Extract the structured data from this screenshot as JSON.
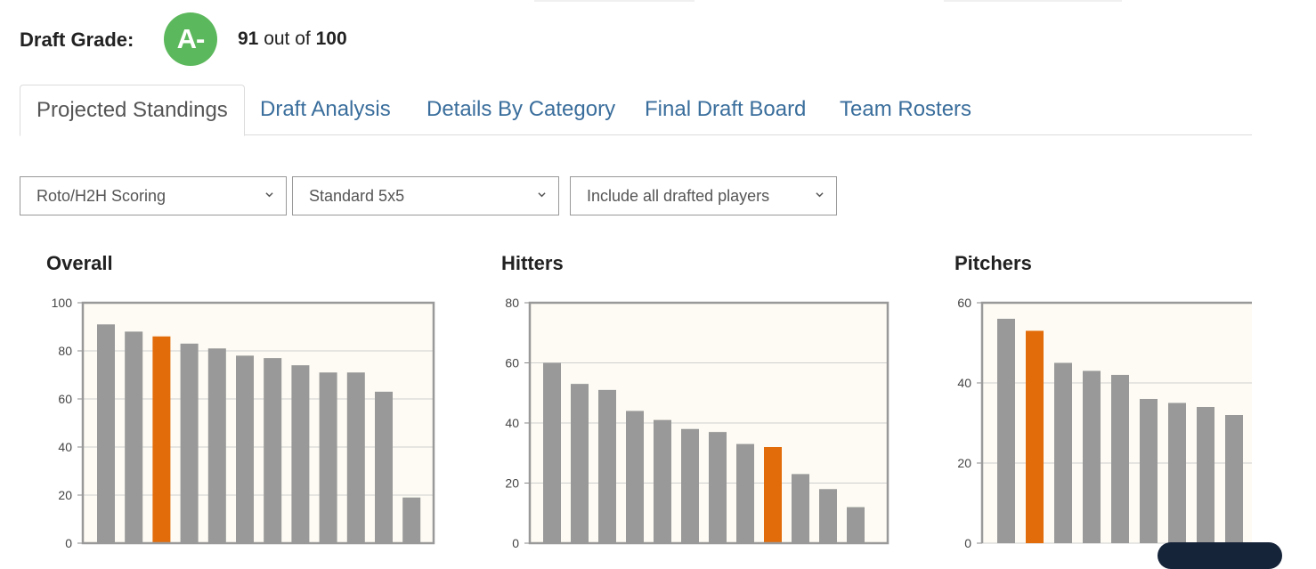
{
  "grade": {
    "label": "Draft Grade:",
    "letter": "A-",
    "score": "91",
    "out_of_text": "out of",
    "max": "100"
  },
  "tabs": [
    {
      "label": "Projected Standings",
      "active": true
    },
    {
      "label": "Draft Analysis",
      "active": false
    },
    {
      "label": "Details By Category",
      "active": false
    },
    {
      "label": "Final Draft Board",
      "active": false
    },
    {
      "label": "Team Rosters",
      "active": false
    }
  ],
  "filters": {
    "scoring": "Roto/H2H Scoring",
    "format": "Standard 5x5",
    "players": "Include all drafted players"
  },
  "colors": {
    "bar": "#999999",
    "highlight": "#e36c0a",
    "plot_bg": "#fdfbf3",
    "grade_green": "#5cb85c"
  },
  "chart_data": [
    {
      "type": "bar",
      "title": "Overall",
      "ylim": [
        0,
        100
      ],
      "yticks": [
        0,
        20,
        40,
        60,
        80,
        100
      ],
      "values": [
        91,
        88,
        86,
        83,
        81,
        78,
        77,
        74,
        71,
        71,
        63,
        19
      ],
      "highlight_index": 2
    },
    {
      "type": "bar",
      "title": "Hitters",
      "ylim": [
        0,
        80
      ],
      "yticks": [
        0,
        20,
        40,
        60,
        80
      ],
      "values": [
        60,
        53,
        51,
        44,
        41,
        38,
        37,
        33,
        32,
        23,
        18,
        12
      ],
      "highlight_index": 8
    },
    {
      "type": "bar",
      "title": "Pitchers",
      "ylim": [
        0,
        60
      ],
      "yticks": [
        0,
        20,
        40,
        60
      ],
      "values": [
        56,
        53,
        45,
        43,
        42,
        36,
        35,
        34,
        32
      ],
      "highlight_index": 1
    }
  ]
}
